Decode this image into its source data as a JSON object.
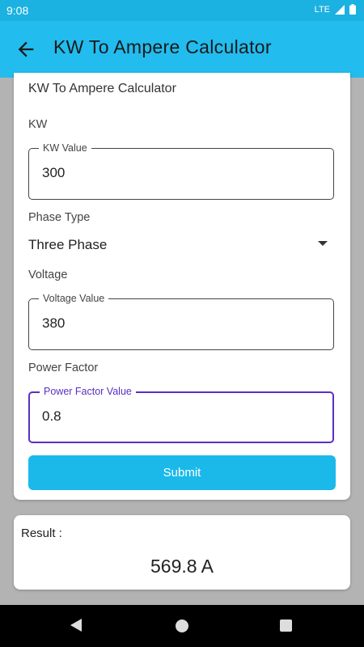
{
  "status_bar": {
    "time": "9:08",
    "network": "LTE"
  },
  "app_bar": {
    "title": "KW To Ampere Calculator",
    "back_icon": "arrow-left-icon"
  },
  "form": {
    "title": "KW To Ampere Calculator",
    "kw": {
      "label": "KW",
      "field_label": "KW Value",
      "value": "300"
    },
    "phase": {
      "label": "Phase Type",
      "selected": "Three Phase"
    },
    "voltage": {
      "label": "Voltage",
      "field_label": "Voltage Value",
      "value": "380"
    },
    "power_factor": {
      "label": "Power Factor",
      "field_label": "Power Factor Value",
      "value": "0.8"
    },
    "submit_label": "Submit"
  },
  "result": {
    "label": "Result :",
    "value": "569.8 A"
  },
  "colors": {
    "app_bar": "#22bcee",
    "status_bar": "#1bb1e0",
    "button": "#1bb9ea",
    "focus": "#5a2fc1"
  }
}
